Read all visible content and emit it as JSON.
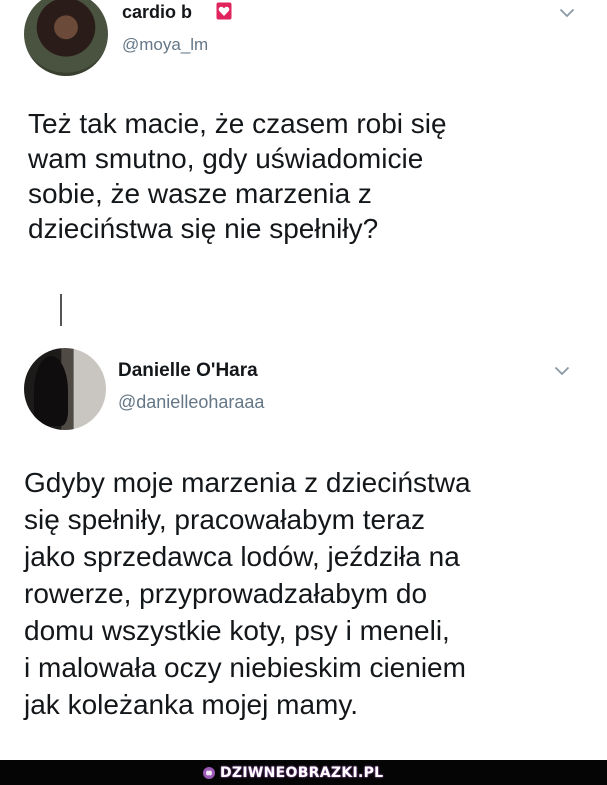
{
  "tweets": [
    {
      "display_name": "cardio b",
      "handle": "@moya_lm",
      "text": "Też tak macie, że czasem robi się\nwam smutno, gdy uświadomicie\nsobie, że wasze marzenia z\ndzieciństwa się nie spełniły?"
    },
    {
      "display_name": "Danielle O'Hara",
      "handle": "@danielleoharaaa",
      "text": "Gdyby moje marzenia z dzieciństwa\nsię spełniły, pracowałabym teraz\njako sprzedawca lodów, jeździła na\nrowerze, przyprowadzałabym do\ndomu wszystkie koty, psy i meneli,\n i malowała oczy niebieskim cieniem\njak koleżanka mojej mamy."
    }
  ],
  "watermark": {
    "text": "DZIWNEOBRAZKI.PL"
  },
  "icons": {
    "badge": "heart-badge-icon",
    "menu": "chevron-down-icon",
    "watermark": "brain-icon"
  },
  "colors": {
    "text": "#14171a",
    "handle": "#657786",
    "badge": "#e0245e",
    "watermark_accent": "#9b59b6"
  }
}
